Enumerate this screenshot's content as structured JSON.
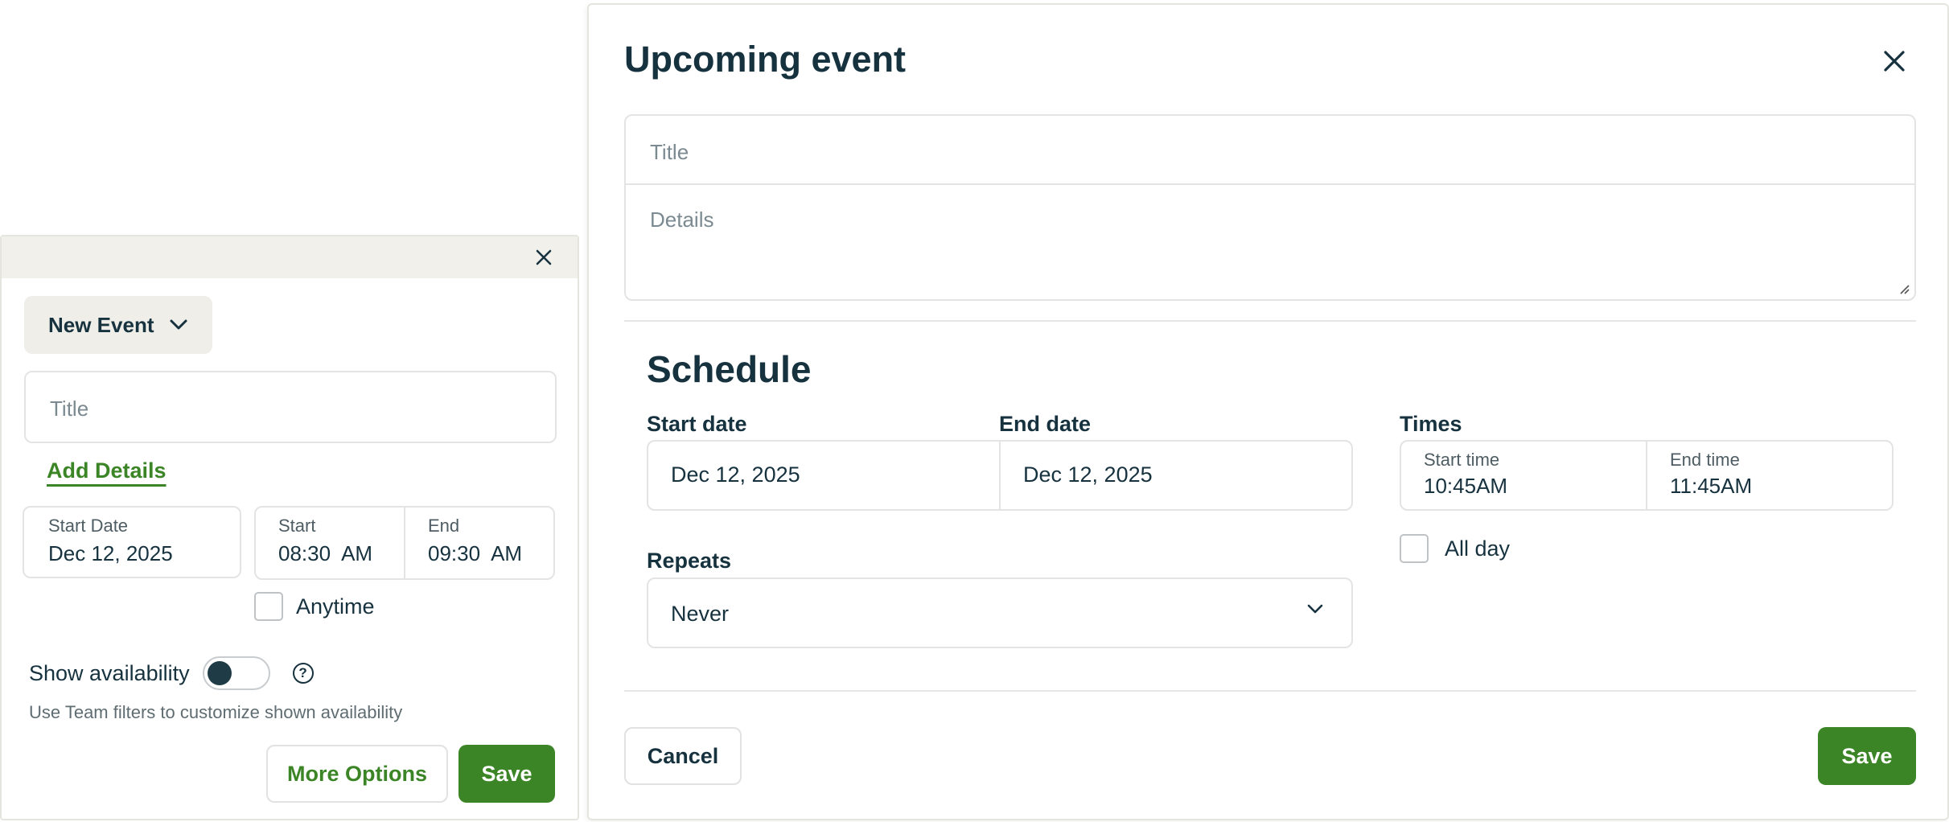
{
  "quick_event": {
    "event_type": "New Event",
    "title_placeholder": "Title",
    "add_details_label": "Add Details",
    "start_date_label": "Start Date",
    "start_date_value": "Dec 12, 2025",
    "start_label": "Start",
    "start_value": "08:30  AM",
    "end_label": "End",
    "end_value": "09:30  AM",
    "anytime_label": "Anytime",
    "anytime_checked": false,
    "availability_label": "Show availability",
    "availability_on": false,
    "help_glyph": "?",
    "availability_hint": "Use Team filters to customize shown availability",
    "more_options_label": "More Options",
    "save_label": "Save"
  },
  "modal": {
    "title": "Upcoming event",
    "title_placeholder": "Title",
    "details_placeholder": "Details",
    "schedule_heading": "Schedule",
    "start_date_label": "Start date",
    "start_date_value": "Dec 12, 2025",
    "end_date_label": "End date",
    "end_date_value": "Dec 12, 2025",
    "times_label": "Times",
    "start_time_label": "Start time",
    "start_time_value": "10:45AM",
    "end_time_label": "End time",
    "end_time_value": "11:45AM",
    "all_day_label": "All day",
    "all_day_checked": false,
    "repeats_label": "Repeats",
    "repeats_value": "Never",
    "cancel_label": "Cancel",
    "save_label": "Save"
  },
  "colors": {
    "accent_green": "#3b8526",
    "text_dark": "#17323f",
    "panel_header": "#f1f0eb"
  },
  "icons": [
    "close-icon",
    "chevron-down-icon",
    "help-icon",
    "resize-grip-icon"
  ]
}
